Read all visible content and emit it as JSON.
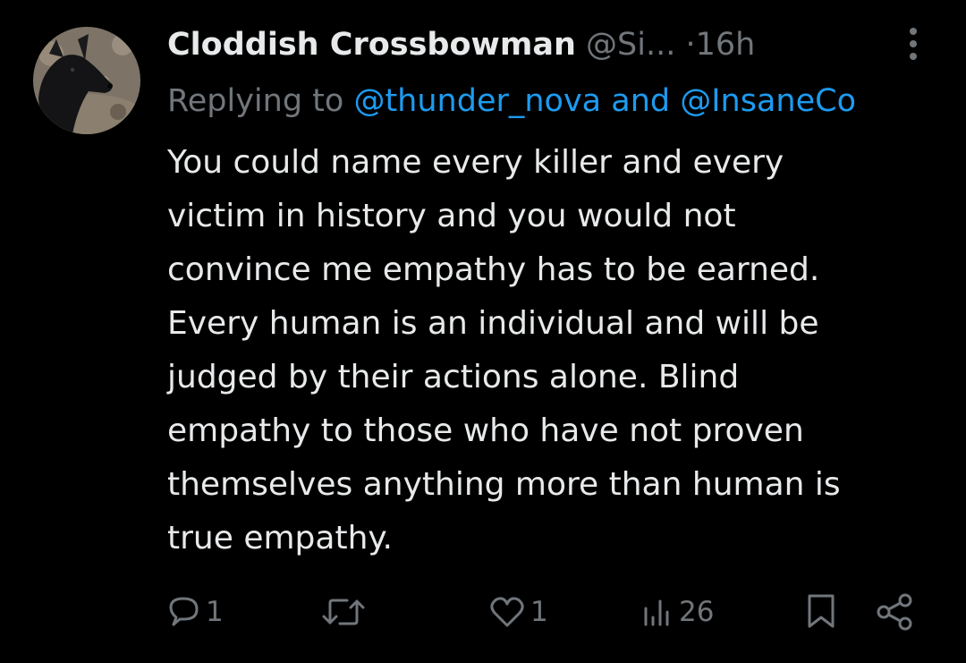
{
  "tweet": {
    "author": {
      "display_name": "Cloddish Crossbowman",
      "handle": "@Si...",
      "avatar_icon": "black-dog-avatar"
    },
    "separator": "·",
    "time": "16h",
    "reply_context": {
      "prefix": "Replying to ",
      "mention_1": "@thunder_nova",
      "connector": " and ",
      "mention_2": "@InsaneCo"
    },
    "text": "You could name every killer and every\nvictim in history and you would not\nconvince me empathy has to be earned.\nEvery human is an individual and will be\njudged by their actions alone. Blind\nempathy to those who have not proven\nthemselves anything more than human is\ntrue empathy.",
    "actions": {
      "reply_count": "1",
      "retweet_count": "",
      "like_count": "1",
      "view_count": "26"
    }
  },
  "colors": {
    "background": "#000000",
    "text_primary": "#e7e9ea",
    "text_secondary": "#71767b",
    "link": "#1d9bf0"
  },
  "icons": [
    "more-vertical-icon",
    "reply-icon",
    "retweet-icon",
    "like-icon",
    "views-icon",
    "bookmark-icon",
    "share-icon"
  ]
}
